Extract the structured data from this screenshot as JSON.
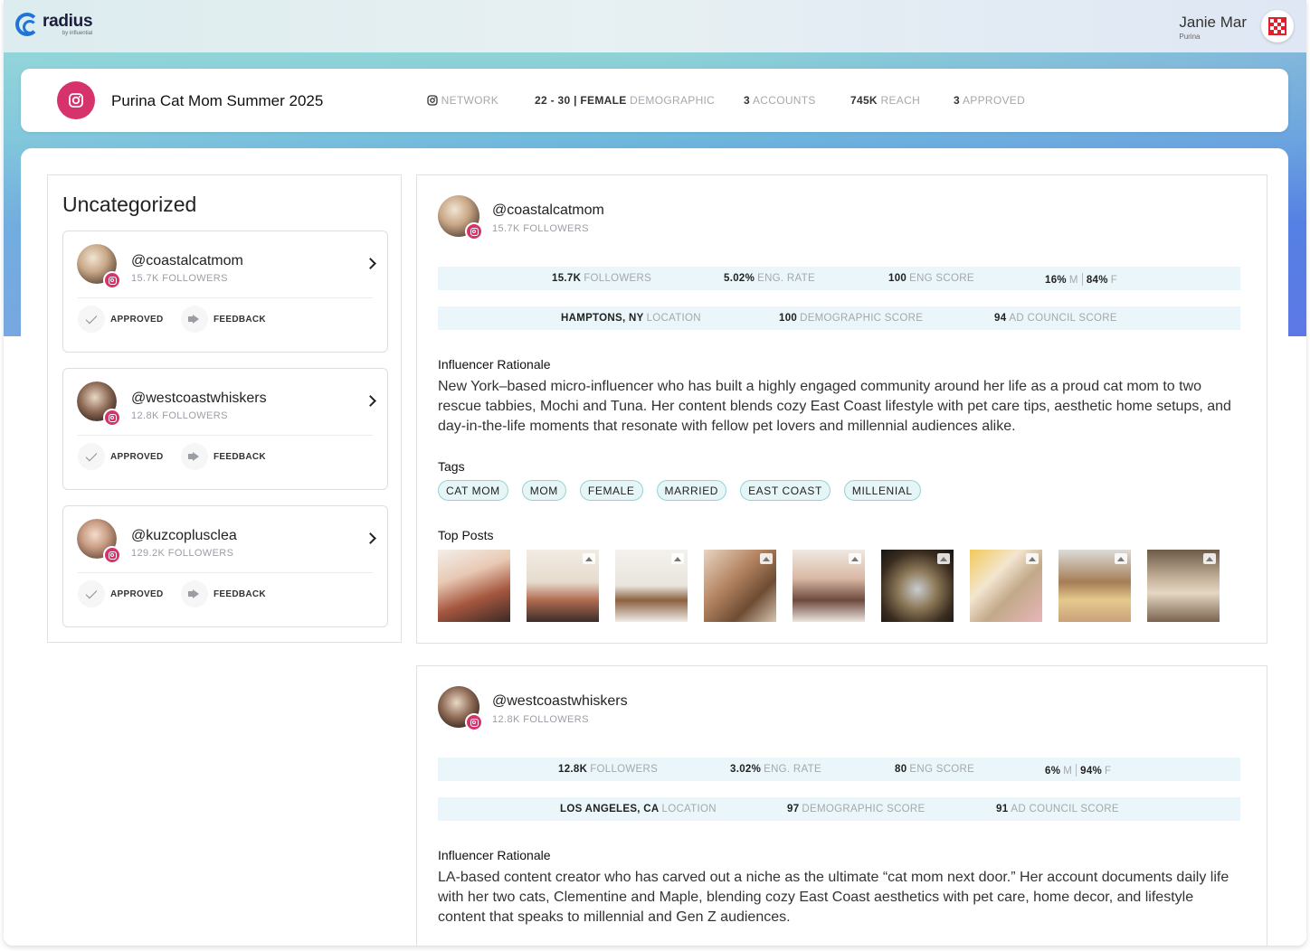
{
  "app": {
    "brand": "radius",
    "brand_sub": "by influential",
    "user_name": "Janie Mar",
    "user_org": "Purina",
    "user_logo_icon": "purina-checkerboard-icon"
  },
  "campaign": {
    "title": "Purina Cat Mom Summer 2025",
    "icon": "instagram-icon",
    "network_label": "NETWORK",
    "demo_value": "22 - 30 | FEMALE",
    "demo_label": "DEMOGRAPHIC",
    "accounts_value": "3",
    "accounts_label": "ACCOUNTS",
    "reach_value": "745K",
    "reach_label": "REACH",
    "approved_value": "3",
    "approved_label": "APPROVED",
    "brand_color": "#d6336c"
  },
  "sidebar": {
    "title": "Uncategorized",
    "accounts": [
      {
        "handle": "@coastalcatmom",
        "followers": "15.7K FOLLOWERS",
        "approved_label": "APPROVED",
        "feedback_label": "FEEDBACK"
      },
      {
        "handle": "@westcoastwhiskers",
        "followers": "12.8K FOLLOWERS",
        "approved_label": "APPROVED",
        "feedback_label": "FEEDBACK"
      },
      {
        "handle": "@kuzcoplusclea",
        "followers": "129.2K FOLLOWERS",
        "approved_label": "APPROVED",
        "feedback_label": "FEEDBACK"
      }
    ]
  },
  "profiles": [
    {
      "handle": "@coastalcatmom",
      "followers_sub": "15.7K FOLLOWERS",
      "stats": {
        "followers_value": "15.7K",
        "followers_label": "FOLLOWERS",
        "eng_rate_value": "5.02%",
        "eng_rate_label": "ENG. RATE",
        "eng_score_value": "100",
        "eng_score_label": "ENG SCORE",
        "male_value": "16%",
        "male_label": "M",
        "female_value": "84%",
        "female_label": "F"
      },
      "meta": {
        "location_value": "HAMPTONS, NY",
        "location_label": "LOCATION",
        "demo_score_value": "100",
        "demo_score_label": "DEMOGRAPHIC SCORE",
        "ad_score_value": "94",
        "ad_score_label": "AD COUNCIL SCORE"
      },
      "rationale_title": "Influencer Rationale",
      "rationale": "New York–based micro-influencer who has built a highly engaged community around her life as a proud cat mom to two rescue tabbies, Mochi and Tuna. Her content blends cozy East Coast lifestyle with pet care tips, aesthetic home setups, and day-in-the-life moments that resonate with fellow pet lovers and millennial audiences alike.",
      "tags_title": "Tags",
      "tags": [
        "CAT MOM",
        "MOM",
        "FEMALE",
        "MARRIED",
        "EAST COAST",
        "MILLENIAL"
      ],
      "posts_title": "Top Posts"
    },
    {
      "handle": "@westcoastwhiskers",
      "followers_sub": "12.8K FOLLOWERS",
      "stats": {
        "followers_value": "12.8K",
        "followers_label": "FOLLOWERS",
        "eng_rate_value": "3.02%",
        "eng_rate_label": "ENG. RATE",
        "eng_score_value": "80",
        "eng_score_label": "ENG SCORE",
        "male_value": "6%",
        "male_label": "M",
        "female_value": "94%",
        "female_label": "F"
      },
      "meta": {
        "location_value": "LOS ANGELES, CA",
        "location_label": "LOCATION",
        "demo_score_value": "97",
        "demo_score_label": "DEMOGRAPHIC SCORE",
        "ad_score_value": "91",
        "ad_score_label": "AD COUNCIL SCORE"
      },
      "rationale_title": "Influencer Rationale",
      "rationale": "LA-based content creator who has carved out a niche as the ultimate “cat mom next door.” Her account documents daily life with her two cats, Clementine and Maple, blending cozy East Coast aesthetics with pet care, home decor, and lifestyle content that speaks to millennial and Gen Z audiences."
    }
  ],
  "colors": {
    "accent": "#d6336c",
    "tag_bg": "#e6f6f7",
    "stat_bar_bg": "#eaf6f9"
  }
}
